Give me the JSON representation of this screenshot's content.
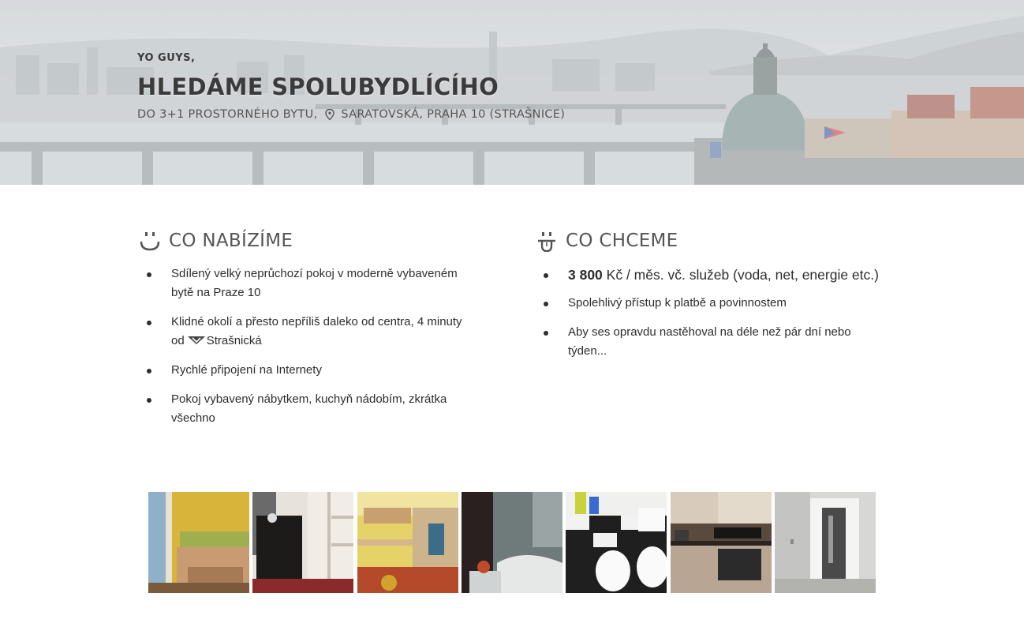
{
  "hero": {
    "kicker": "YO GUYS,",
    "title": "HLEDÁME SPOLUBYDLÍCÍHO",
    "subtitle_part1": "DO 3+1 PROSTORNÉHO BYTU,",
    "location_icon": "map-pin-icon",
    "subtitle_part2": "SARATOVSKÁ, PRAHA 10 (STRAŠNICE)"
  },
  "offer": {
    "icon": "smiley-face-icon",
    "heading": "CO NABÍZÍME",
    "items": [
      {
        "text": "Sdílený velký neprůchozí pokoj v moderně vybaveném bytě na Praze 10"
      },
      {
        "text_before": "Klidné okolí a přesto nepříliš daleko od centra, 4 minuty od",
        "metro_icon": "metro-logo-icon",
        "text_after": "Strašnická"
      },
      {
        "text": "Rychlé připojení na Internety"
      },
      {
        "text": "Pokoj vybavený nábytkem, kuchyň nádobím, zkrátka všechno"
      }
    ]
  },
  "want": {
    "icon": "tongue-face-icon",
    "heading": "CO CHCEME",
    "items": [
      {
        "price": "3 800",
        "text": "Kč / měs. vč. služeb (voda, net, energie etc.)"
      },
      {
        "text": "Spolehlivý přístup k platbě a povinnostem"
      },
      {
        "text": "Aby ses opravdu nastěhoval na déle než pár dní nebo týden..."
      }
    ]
  },
  "gallery": {
    "photos": [
      "bedroom-bed-photo",
      "wardrobe-photo",
      "desk-room-photo",
      "shower-photo",
      "bathroom-toilet-photo",
      "kitchen-photo",
      "hallway-door-photo"
    ]
  },
  "colors": {
    "heading": "#555555",
    "text": "#2d2d2d",
    "hero_title": "#3b3b3b"
  }
}
